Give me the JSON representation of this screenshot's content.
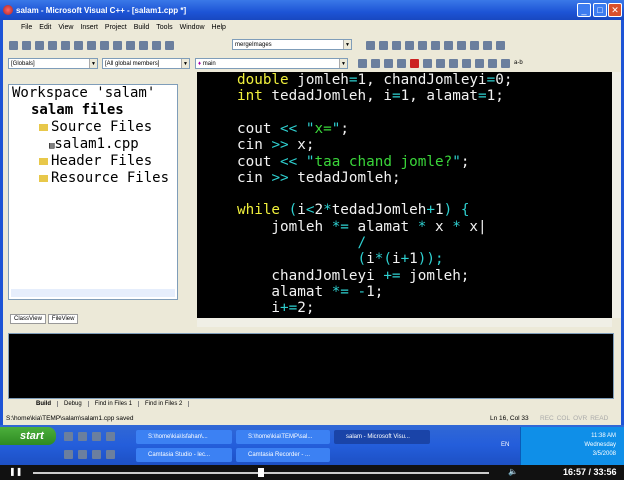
{
  "window": {
    "title": "salam - Microsoft Visual C++ - [salam1.cpp *]",
    "min": "_",
    "max": "□",
    "close": "✕"
  },
  "menu": [
    "File",
    "Edit",
    "View",
    "Insert",
    "Project",
    "Build",
    "Tools",
    "Window",
    "Help"
  ],
  "toolbar": {
    "find_combo": "mergeImages",
    "globals_combo": "[Globals]",
    "members_combo": "[All global members]",
    "function_combo": "main",
    "ab_label": "a-b"
  },
  "workspace": {
    "items": [
      "Workspace 'salam'",
      "salam files",
      "Source Files",
      "salam1.cpp",
      "Header Files",
      "Resource Files"
    ],
    "tabs": [
      "ClassView",
      "FileView"
    ]
  },
  "code": [
    [
      [
        "k",
        "double"
      ],
      [
        "i",
        " jomleh"
      ],
      [
        "o",
        "="
      ],
      [
        "i",
        "1, chandJomleyi"
      ],
      [
        "o",
        "="
      ],
      [
        "i",
        "0;"
      ]
    ],
    [
      [
        "k",
        "int"
      ],
      [
        "i",
        " tedadJomleh, i"
      ],
      [
        "o",
        "="
      ],
      [
        "i",
        "1, alamat"
      ],
      [
        "o",
        "="
      ],
      [
        "i",
        "1;"
      ]
    ],
    [],
    [
      [
        "i",
        "cout "
      ],
      [
        "o",
        "<<"
      ],
      [
        "i",
        " "
      ],
      [
        "o",
        "\""
      ],
      [
        "s",
        "x="
      ],
      [
        "o",
        "\""
      ],
      [
        "i",
        ";"
      ]
    ],
    [
      [
        "i",
        "cin "
      ],
      [
        "o",
        ">>"
      ],
      [
        "i",
        " x;"
      ]
    ],
    [
      [
        "i",
        "cout "
      ],
      [
        "o",
        "<<"
      ],
      [
        "i",
        " "
      ],
      [
        "o",
        "\""
      ],
      [
        "s",
        "taa chand jomle?"
      ],
      [
        "o",
        "\""
      ],
      [
        "i",
        ";"
      ]
    ],
    [
      [
        "i",
        "cin "
      ],
      [
        "o",
        ">>"
      ],
      [
        "i",
        " tedadJomleh;"
      ]
    ],
    [],
    [
      [
        "k",
        "while"
      ],
      [
        "i",
        " "
      ],
      [
        "o",
        "("
      ],
      [
        "i",
        "i"
      ],
      [
        "o",
        "<"
      ],
      [
        "i",
        "2"
      ],
      [
        "o",
        "*"
      ],
      [
        "i",
        "tedadJomleh"
      ],
      [
        "o",
        "+"
      ],
      [
        "i",
        "1"
      ],
      [
        "o",
        ")"
      ],
      [
        "i",
        " "
      ],
      [
        "o",
        "{"
      ]
    ],
    [
      [
        "i",
        "    jomleh "
      ],
      [
        "o",
        "*="
      ],
      [
        "i",
        " alamat "
      ],
      [
        "o",
        "*"
      ],
      [
        "i",
        " x "
      ],
      [
        "o",
        "*"
      ],
      [
        "i",
        " x|"
      ]
    ],
    [
      [
        "o",
        "              /"
      ]
    ],
    [
      [
        "i",
        "              "
      ],
      [
        "o",
        "("
      ],
      [
        "i",
        "i"
      ],
      [
        "o",
        "*("
      ],
      [
        "i",
        "i"
      ],
      [
        "o",
        "+"
      ],
      [
        "i",
        "1"
      ],
      [
        "o",
        "));"
      ]
    ],
    [
      [
        "i",
        "    chandJomleyi "
      ],
      [
        "o",
        "+="
      ],
      [
        "i",
        " jomleh;"
      ]
    ],
    [
      [
        "i",
        "    alamat "
      ],
      [
        "o",
        "*="
      ],
      [
        "i",
        " "
      ],
      [
        "o",
        "-"
      ],
      [
        "i",
        "1;"
      ]
    ],
    [
      [
        "i",
        "    i"
      ],
      [
        "o",
        "+="
      ],
      [
        "i",
        "2;"
      ]
    ]
  ],
  "output": {
    "tabs": [
      "Build",
      "Debug",
      "Find in Files 1",
      "Find in Files 2"
    ]
  },
  "status": {
    "message": "S:\\home\\kia\\TEMP\\salam\\salam1.cpp saved",
    "position": "Ln 16, Col 33",
    "indicators": [
      "REC",
      "COL",
      "OVR",
      "READ"
    ]
  },
  "taskbar": {
    "start": "start",
    "tasks": [
      "S:\\home\\kia\\Isfahan\\...",
      "S:\\home\\kia\\TEMP\\sal...",
      "salam - Microsoft Visu...",
      "Camtasia Studio - lec...",
      "Camtasia Recorder - ..."
    ],
    "lang": "EN",
    "time": "11:38 AM",
    "day": "Wednesday",
    "date": "3/5/2008"
  },
  "player": {
    "time": "16:57 / 33:56",
    "progress": 0.5,
    "pause": "❚❚"
  }
}
